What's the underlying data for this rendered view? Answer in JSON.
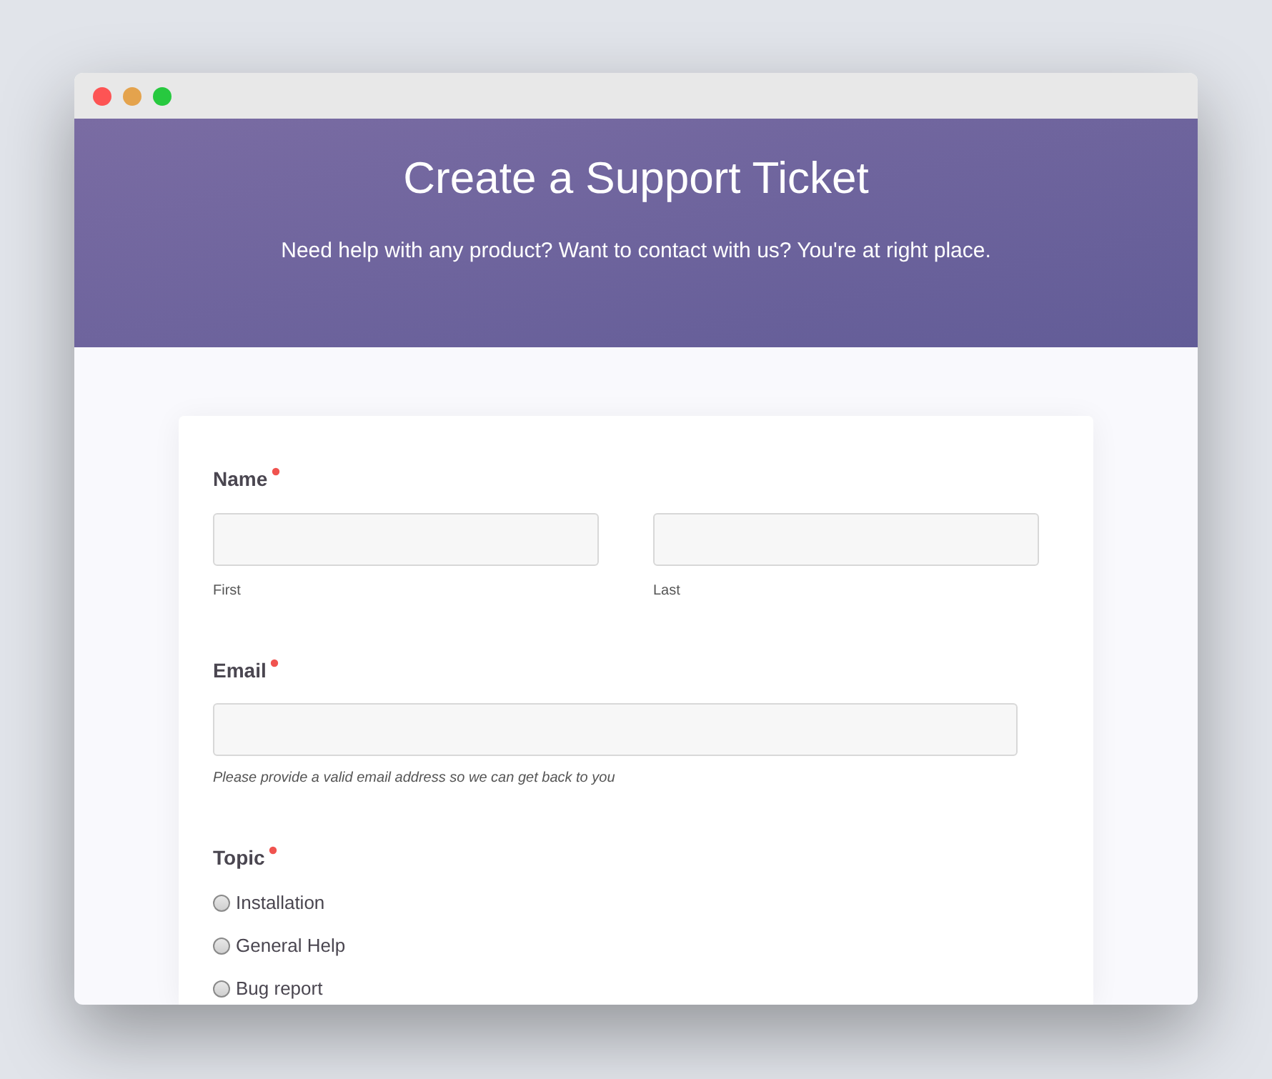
{
  "header": {
    "title": "Create a Support Ticket",
    "subtitle": "Need help with any product? Want to contact with us? You're at right place."
  },
  "form": {
    "name_field": {
      "label": "Name",
      "required": true,
      "parts": [
        {
          "sublabel": "First"
        },
        {
          "sublabel": "Last"
        }
      ]
    },
    "email_field": {
      "label": "Email",
      "required": true,
      "help": "Please provide a valid email address so we can get back to you"
    },
    "topic_field": {
      "label": "Topic",
      "required": true,
      "options": [
        {
          "label": "Installation",
          "selected": false
        },
        {
          "label": "General Help",
          "selected": false
        },
        {
          "label": "Bug report",
          "selected": false
        }
      ]
    }
  }
}
